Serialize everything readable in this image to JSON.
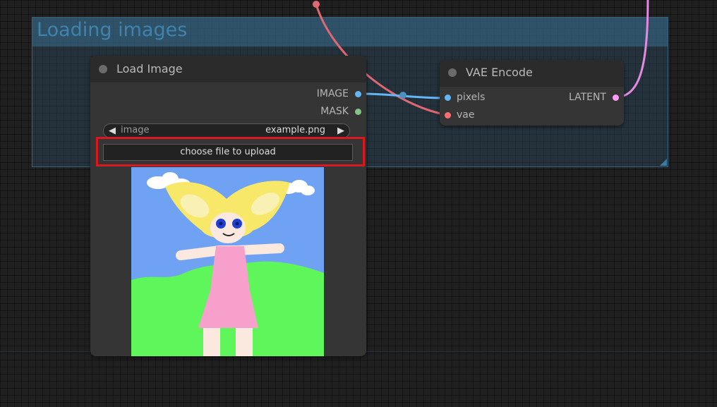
{
  "group": {
    "title": "Loading images"
  },
  "load_image_node": {
    "title": "Load Image",
    "outputs": [
      {
        "label": "IMAGE",
        "color": "#64b5f6"
      },
      {
        "label": "MASK",
        "color": "#81c784"
      }
    ],
    "image_widget": {
      "label": "image",
      "value": "example.png"
    },
    "upload_button_label": "choose file to upload"
  },
  "vae_encode_node": {
    "title": "VAE Encode",
    "inputs": [
      {
        "label": "pixels",
        "color": "#64b5f6"
      },
      {
        "label": "vae",
        "color": "#ff6e6e"
      }
    ],
    "outputs": [
      {
        "label": "LATENT",
        "color": "#ff9cf9"
      }
    ]
  },
  "links": {
    "image_color": "#64b5f6",
    "vae_color": "#e06872",
    "latent_color": "#e58ae3"
  },
  "highlight_color": "#d8191f"
}
